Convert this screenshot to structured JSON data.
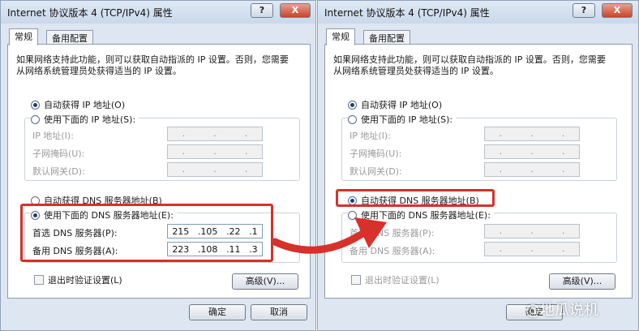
{
  "left": {
    "title": "Internet 协议版本 4 (TCP/IPv4) 属性",
    "help_glyph": "?",
    "close_glyph": "X",
    "tabs": [
      "常规",
      "备用配置"
    ],
    "intro": "如果网络支持此功能，则可以获取自动指派的 IP 设置。否则，您需要从网络系统管理员处获得适当的 IP 设置。",
    "auto_ip_label": "自动获得 IP 地址(O)",
    "manual_ip_label": "使用下面的 IP 地址(S):",
    "ip_address_label": "IP 地址(I):",
    "subnet_label": "子网掩码(U):",
    "gateway_label": "默认网关(D):",
    "empty_ip": [
      ".",
      ".",
      "."
    ],
    "auto_dns_label": "自动获得 DNS 服务器地址(B)",
    "manual_dns_label": "使用下面的 DNS 服务器地址(E):",
    "preferred_dns_label": "首选 DNS 服务器(P):",
    "alternate_dns_label": "备用 DNS 服务器(A):",
    "preferred_dns": [
      "215",
      ".105",
      ".22",
      ".1"
    ],
    "alternate_dns": [
      "223",
      ".108",
      ".11",
      ".3"
    ],
    "validate_label": "退出时验证设置(L)",
    "advanced_label": "高级(V)...",
    "ok_label": "确定",
    "cancel_label": "取消"
  },
  "right": {
    "title": "Internet 协议版本 4 (TCP/IPv4) 属性",
    "help_glyph": "?",
    "close_glyph": "X",
    "tabs": [
      "常规",
      "备用配置"
    ],
    "intro": "如果网络支持此功能，则可以获取自动指派的 IP 设置。否则，您需要从网络系统管理员处获得适当的 IP 设置。",
    "auto_ip_label": "自动获得 IP 地址(O)",
    "manual_ip_label": "使用下面的 IP 地址(S):",
    "ip_address_label": "IP 地址(I):",
    "subnet_label": "子网掩码(U):",
    "gateway_label": "默认网关(D):",
    "empty_ip": [
      ".",
      ".",
      "."
    ],
    "auto_dns_label": "自动获得 DNS 服务器地址(B)",
    "manual_dns_label": "使用下面的 DNS 服务器地址(E):",
    "preferred_dns_label": "首选 DNS 服务器(P):",
    "alternate_dns_label": "备用 DNS 服务器(A):",
    "validate_label": "退出时验证设置(L)",
    "advanced_label": "高级(V)...",
    "ok_label": "确定"
  },
  "watermark": "@地瓜说机",
  "colors": {
    "highlight": "#d8302a",
    "dialog_bg": "#dde6f1",
    "titlebar": "#c9d8ea"
  }
}
